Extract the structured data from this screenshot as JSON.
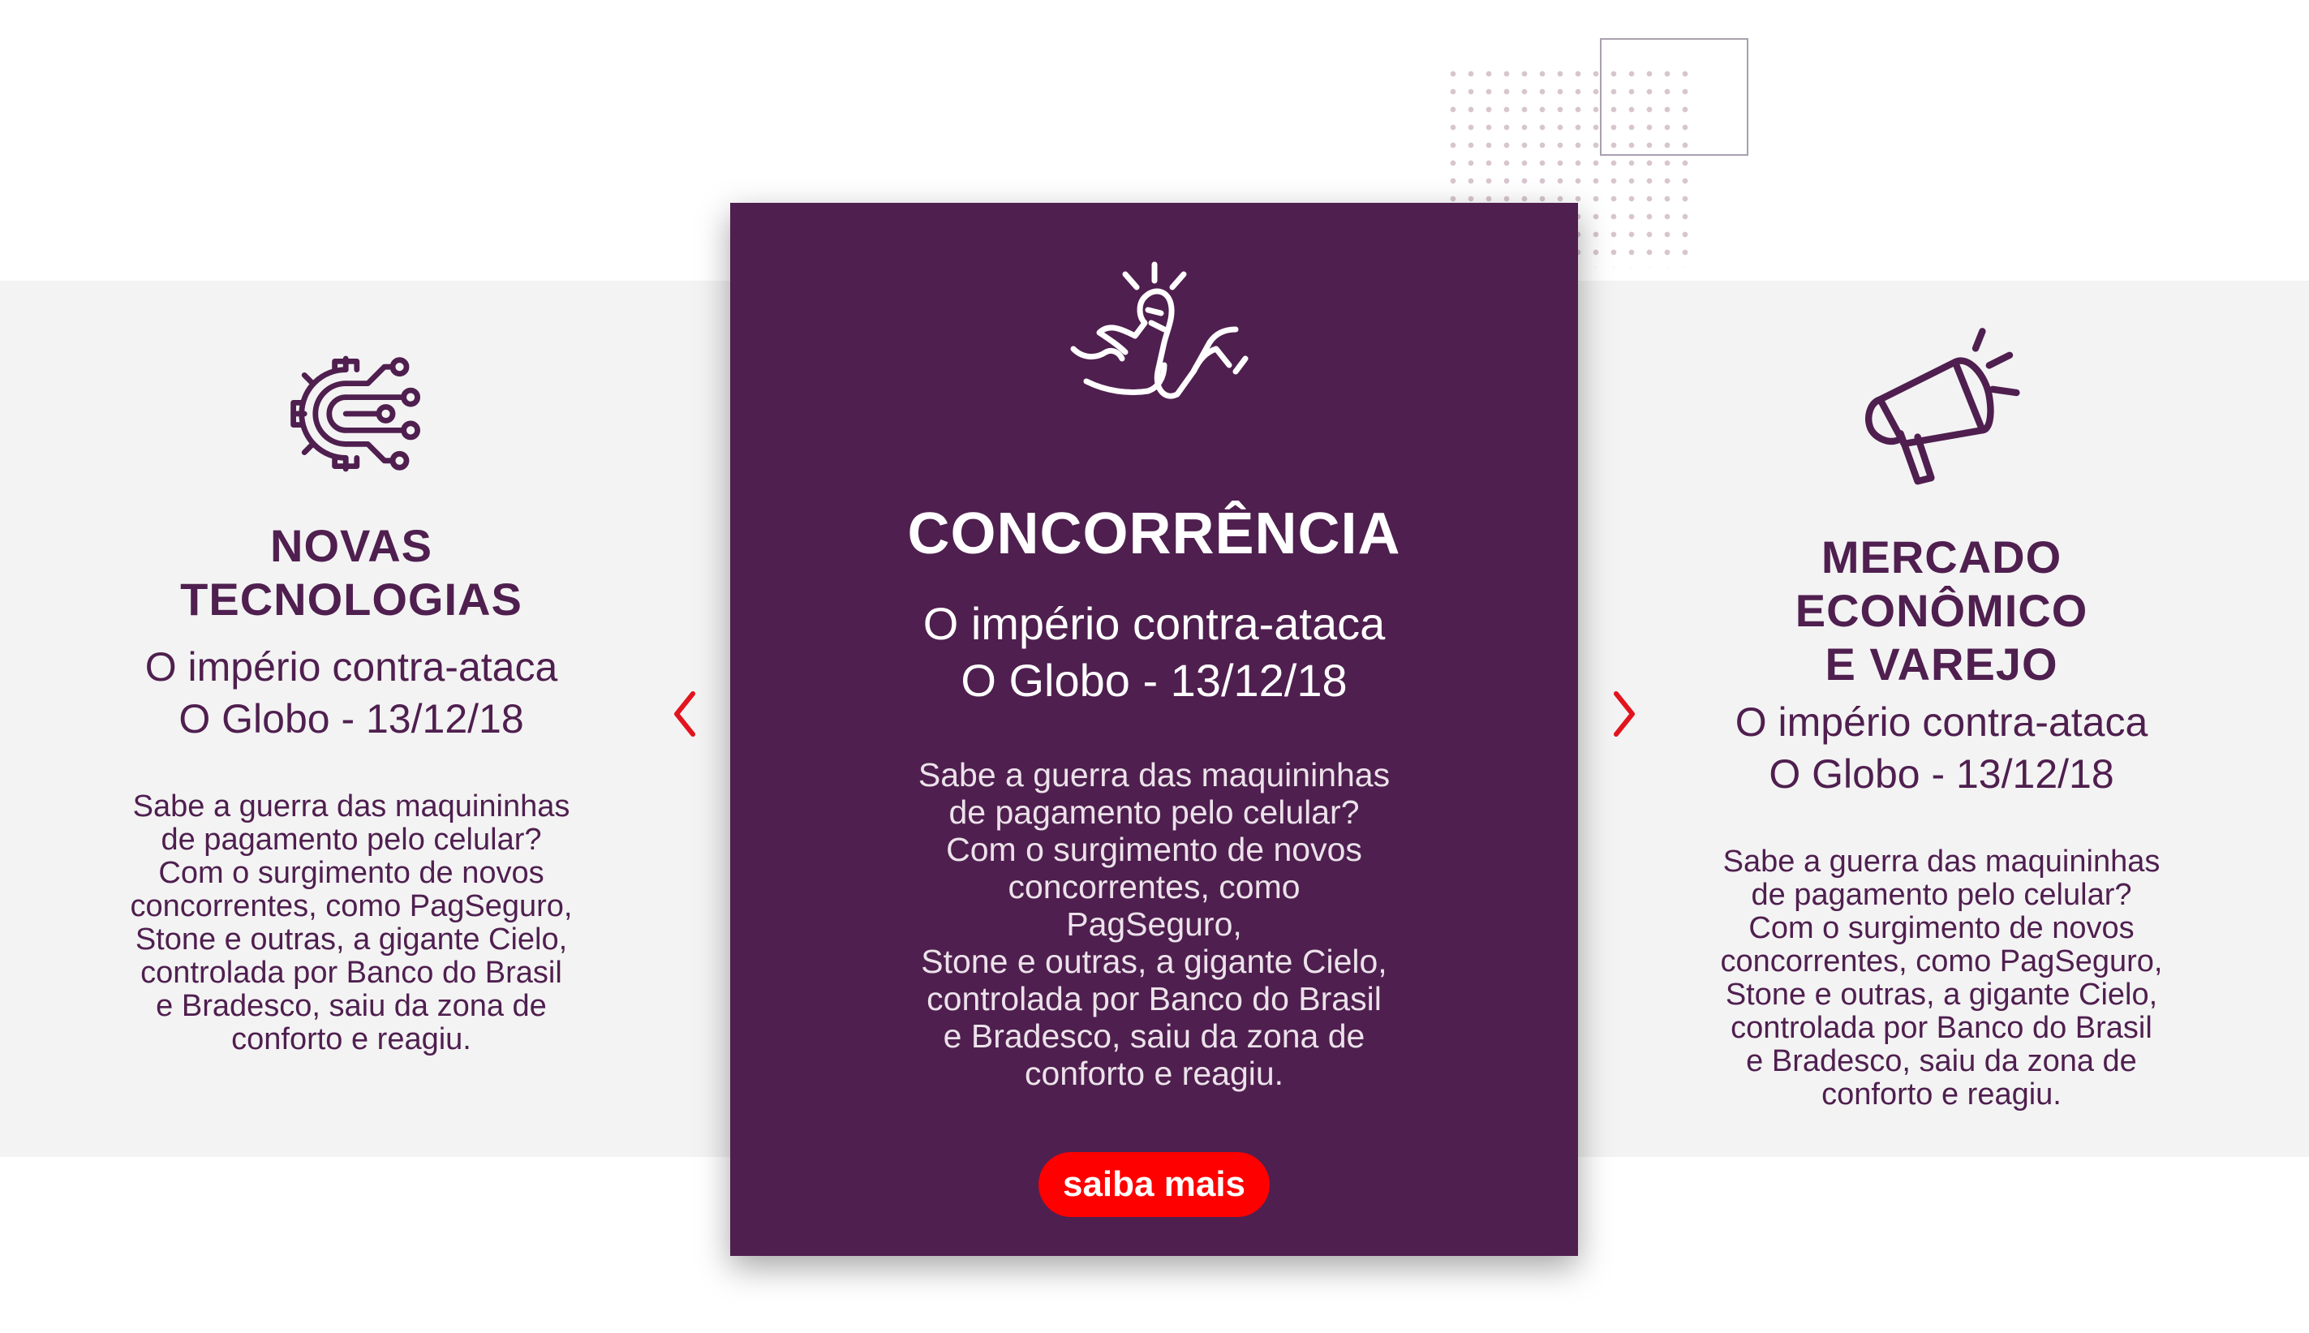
{
  "colors": {
    "brand_purple": "#4f1f4f",
    "accent_red": "#ff0000",
    "band_gray": "#f3f3f3"
  },
  "carousel": {
    "prev_icon": "chevron-left-icon",
    "next_icon": "chevron-right-icon",
    "cards": [
      {
        "icon": "gear-circuit-icon",
        "title": "NOVAS TECNOLOGIAS",
        "subtitle_line1": "O império contra-ataca",
        "subtitle_line2": "O Globo - 13/12/18",
        "body": [
          "Sabe a guerra das maquininhas",
          "de pagamento pelo celular?",
          "Com o surgimento de novos",
          "concorrentes, como PagSeguro,",
          "Stone e outras, a gigante Cielo,",
          "controlada por Banco do Brasil",
          "e Bradesco, saiu da zona de",
          "conforto e reagiu."
        ]
      },
      {
        "icon": "arm-wrestling-icon",
        "title": "CONCORRÊNCIA",
        "subtitle_line1": "O império contra-ataca",
        "subtitle_line2": "O Globo - 13/12/18",
        "body": [
          "Sabe a guerra das maquininhas",
          "de pagamento pelo celular?",
          "Com o surgimento de novos",
          "concorrentes, como PagSeguro,",
          "Stone e outras, a gigante Cielo,",
          "controlada por Banco do Brasil",
          "e Bradesco, saiu da zona de",
          "conforto e reagiu."
        ],
        "cta_label": "saiba mais"
      },
      {
        "icon": "megaphone-icon",
        "title_line1": "MERCADO ECONÔMICO",
        "title_line2": "E VAREJO",
        "subtitle_line1": "O império contra-ataca",
        "subtitle_line2": "O Globo - 13/12/18",
        "body": [
          "Sabe a guerra das maquininhas",
          "de pagamento pelo celular?",
          "Com o surgimento de novos",
          "concorrentes, como PagSeguro,",
          "Stone e outras, a gigante Cielo,",
          "controlada por Banco do Brasil",
          "e Bradesco, saiu da zona de",
          "conforto e reagiu."
        ]
      }
    ]
  }
}
